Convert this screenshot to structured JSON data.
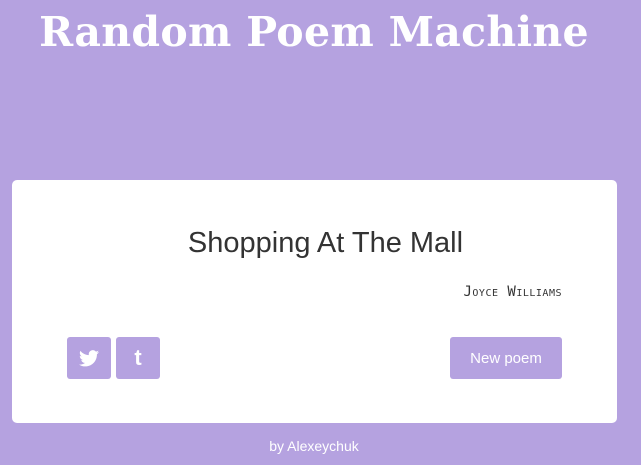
{
  "app": {
    "title": "Random Poem Machine"
  },
  "poem": {
    "title": "Shopping At The Mall",
    "author": "Joyce Williams"
  },
  "actions": {
    "twitter_icon": "twitter-icon",
    "tumblr_icon": "tumblr-icon",
    "tumblr_glyph": "t",
    "new_poem_label": "New poem"
  },
  "footer": {
    "prefix": "by",
    "author_link": "Alexeychuk"
  },
  "colors": {
    "background": "#b5a2e0",
    "card": "#ffffff",
    "text": "#333333",
    "button": "#b5a2e0"
  }
}
